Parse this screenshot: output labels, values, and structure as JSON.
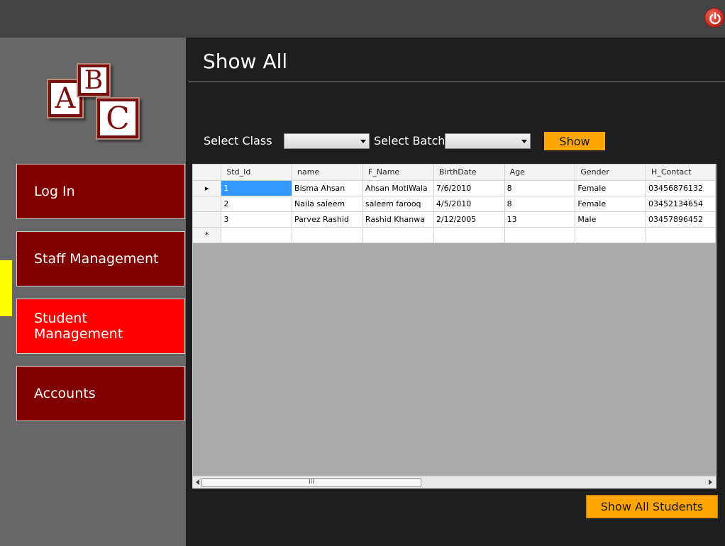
{
  "window": {
    "title": "Show All"
  },
  "logo": {
    "letters": [
      "A",
      "B",
      "C"
    ]
  },
  "nav": {
    "items": [
      {
        "label": "Log In",
        "active": false
      },
      {
        "label": "Staff Management",
        "active": false
      },
      {
        "label": "Student Management",
        "active": true
      },
      {
        "label": "Accounts",
        "active": false
      }
    ]
  },
  "filters": {
    "class_label": "Select Class",
    "class_value": "",
    "batch_label": "Select Batch",
    "batch_value": "",
    "show_label": "Show"
  },
  "grid": {
    "columns": [
      "Std_Id",
      "name",
      "F_Name",
      "BirthDate",
      "Age",
      "Gender",
      "H_Contact"
    ],
    "rows": [
      [
        "1",
        "Bisma Ahsan",
        "Ahsan MotiWala",
        "7/6/2010",
        "8",
        "Female",
        "03456876132"
      ],
      [
        "2",
        "Naila saleem",
        "saleem farooq",
        "4/5/2010",
        "8",
        "Female",
        "03452134654"
      ],
      [
        "3",
        "Parvez Rashid",
        "Rashid Khanwa",
        "2/12/2005",
        "13",
        "Male",
        "03457896452"
      ]
    ],
    "current_row_marker": "▸",
    "new_row_marker": "*",
    "scroll_thumb_label": "III"
  },
  "actions": {
    "show_all_label": "Show All Students"
  },
  "colors": {
    "accent": "#ffa500",
    "nav": "#800000",
    "nav_active": "#ff0000",
    "marker": "#ffff00"
  }
}
